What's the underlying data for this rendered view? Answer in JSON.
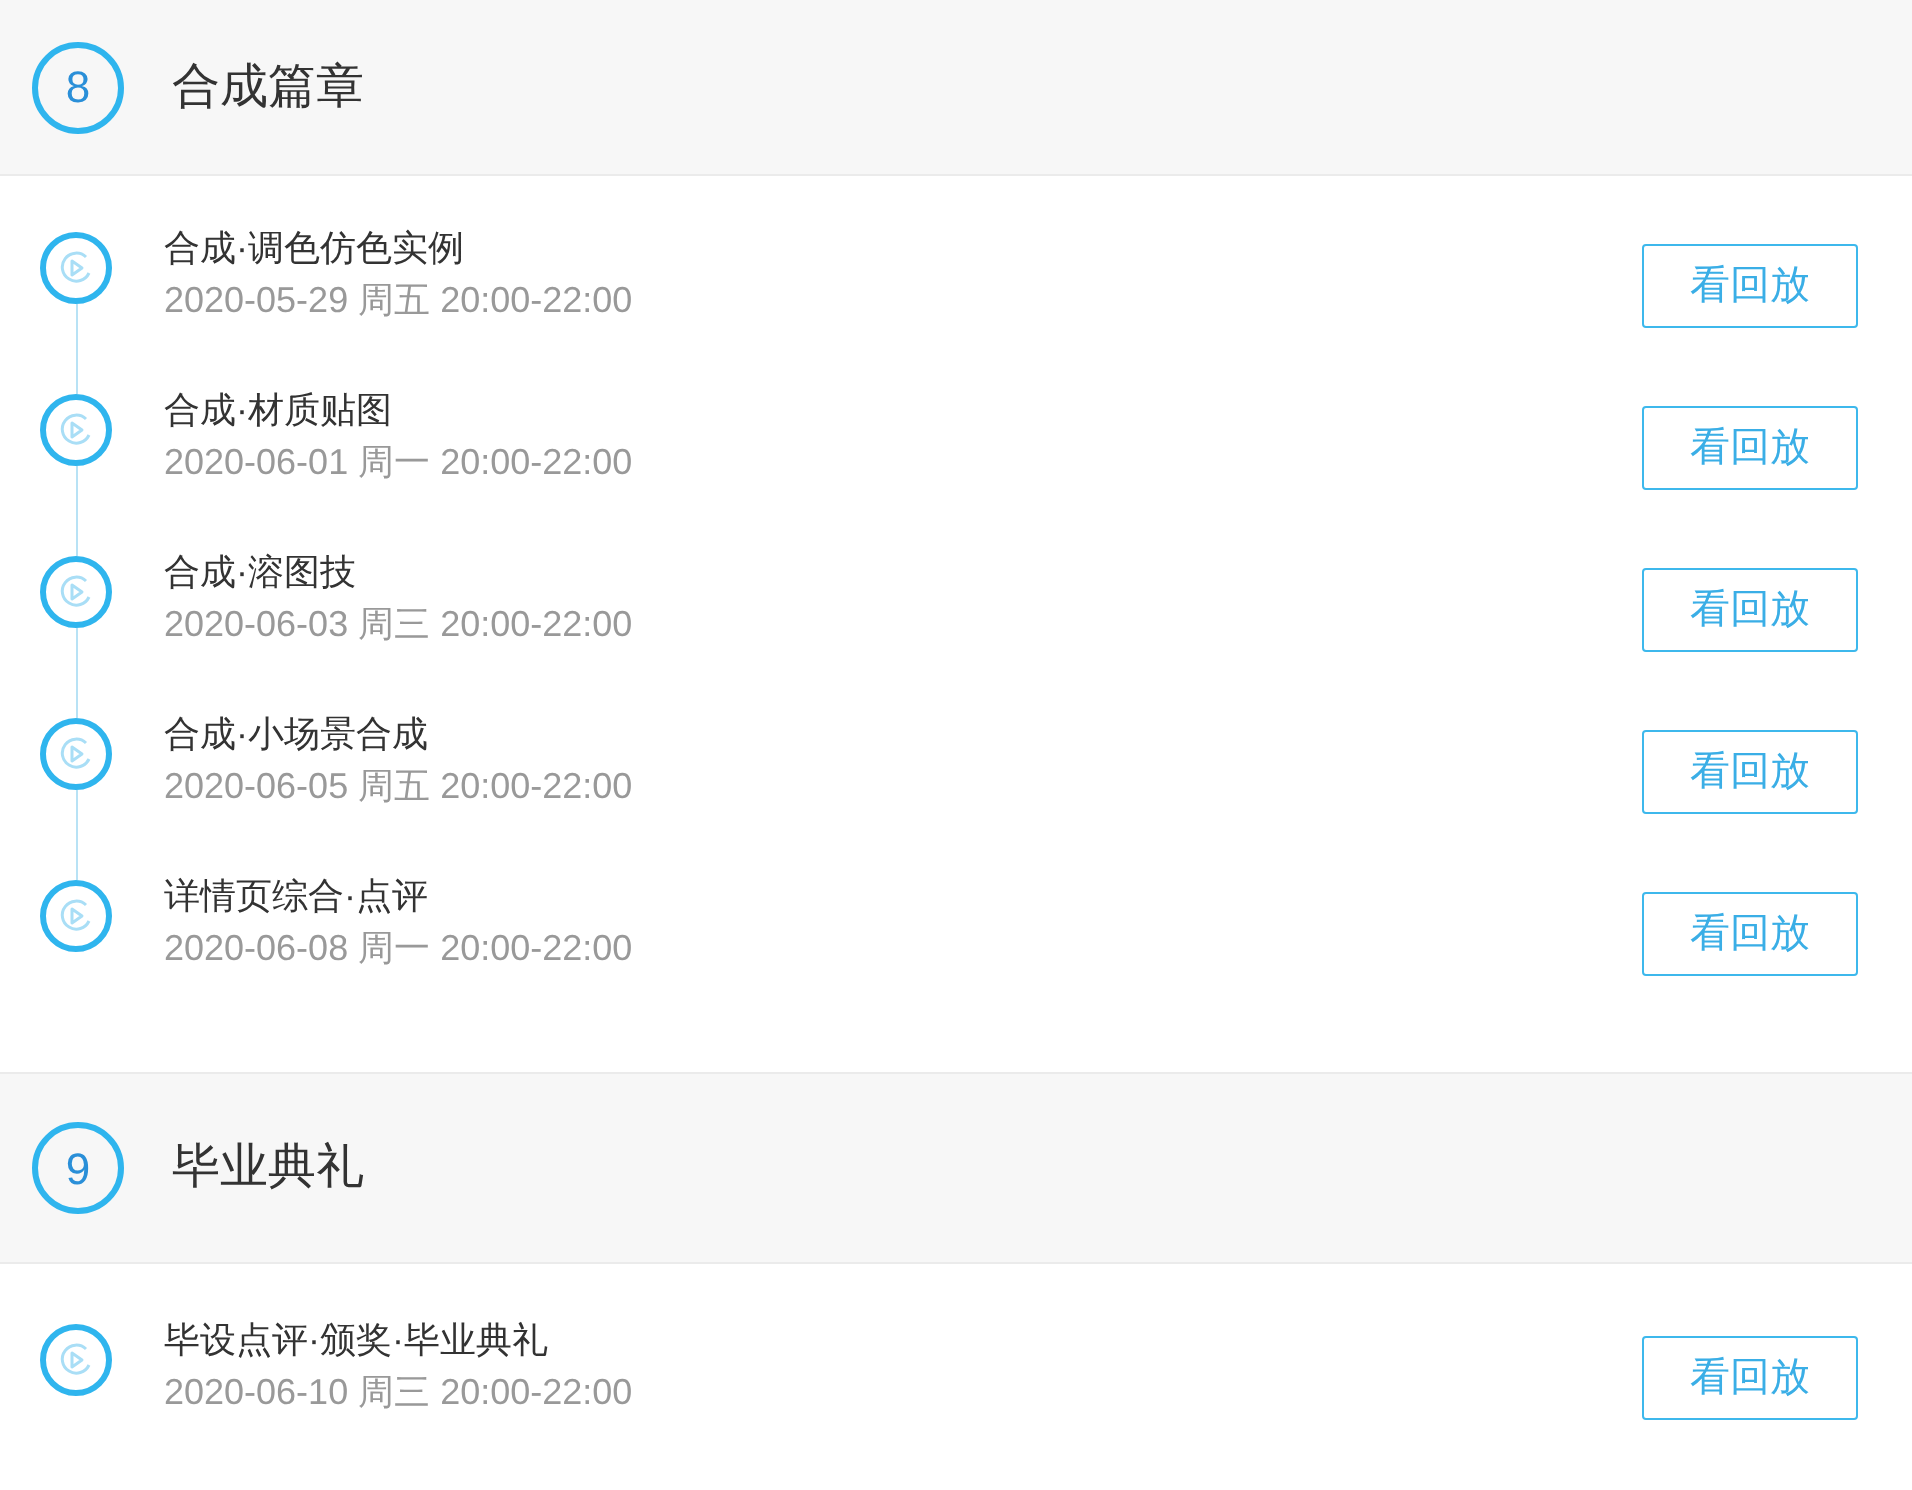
{
  "sections": [
    {
      "number": "8",
      "title": "合成篇章",
      "lessons": [
        {
          "title": "合成·调色仿色实例",
          "time": "2020-05-29 周五 20:00-22:00",
          "button": "看回放"
        },
        {
          "title": "合成·材质贴图",
          "time": "2020-06-01 周一 20:00-22:00",
          "button": "看回放"
        },
        {
          "title": "合成·溶图技",
          "time": "2020-06-03 周三 20:00-22:00",
          "button": "看回放"
        },
        {
          "title": "合成·小场景合成",
          "time": "2020-06-05 周五 20:00-22:00",
          "button": "看回放"
        },
        {
          "title": "详情页综合·点评",
          "time": "2020-06-08 周一 20:00-22:00",
          "button": "看回放"
        }
      ]
    },
    {
      "number": "9",
      "title": "毕业典礼",
      "lessons": [
        {
          "title": "毕设点评·颁奖·毕业典礼",
          "time": "2020-06-10 周三 20:00-22:00",
          "button": "看回放"
        }
      ]
    }
  ]
}
